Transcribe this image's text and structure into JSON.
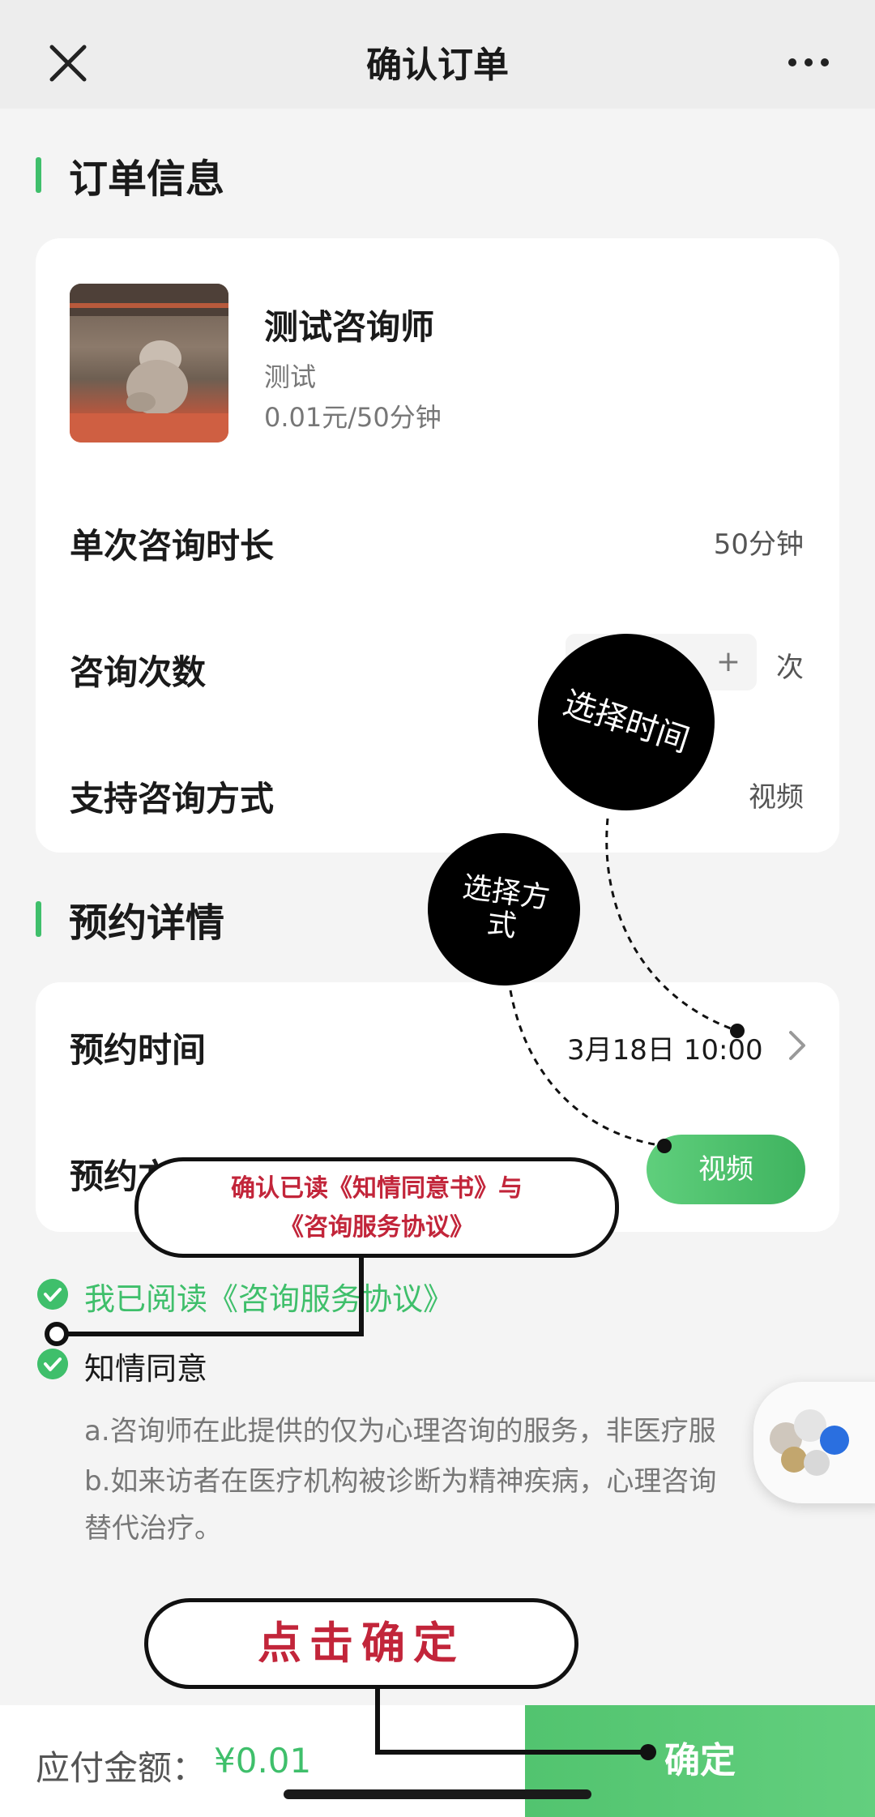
{
  "header": {
    "title": "确认订单",
    "close_icon": "close-icon",
    "more_icon": "more-icon"
  },
  "order_section": {
    "title": "订单信息"
  },
  "counselor": {
    "name": "测试咨询师",
    "tag": "测试",
    "price": "0.01元/50分钟"
  },
  "order_rows": {
    "duration_label": "单次咨询时长",
    "duration_value": "50分钟",
    "count_label": "咨询次数",
    "count_plus": "+",
    "count_unit": "次",
    "mode_label": "支持咨询方式",
    "mode_value": "视频"
  },
  "booking_section": {
    "title": "预约详情"
  },
  "booking": {
    "time_label": "预约时间",
    "time_value": "3月18日 10:00",
    "mode_label": "预约方式",
    "mode_option": "视频"
  },
  "agreements": {
    "read_text": "我已阅读《咨询服务协议》",
    "consent_text": "知情同意",
    "notice_a": "a.咨询师在此提供的仅为心理咨询的服务，非医疗服",
    "notice_b": "b.如来访者在医疗机构被诊断为精神疾病，心理咨询",
    "notice_c": "替代治疗。"
  },
  "footer": {
    "amount_label": "应付金额：",
    "amount_value": "¥0.01",
    "confirm_label": "确定"
  },
  "annotations": {
    "choose_time": "选择时间",
    "choose_mode": "选择方式",
    "confirm_read_line1": "确认已读《知情同意书》与",
    "confirm_read_line2": "《咨询服务协议》",
    "click_confirm": "点击确定"
  },
  "colors": {
    "accent": "#3fbf6b",
    "annotation_red": "#c2253a"
  }
}
